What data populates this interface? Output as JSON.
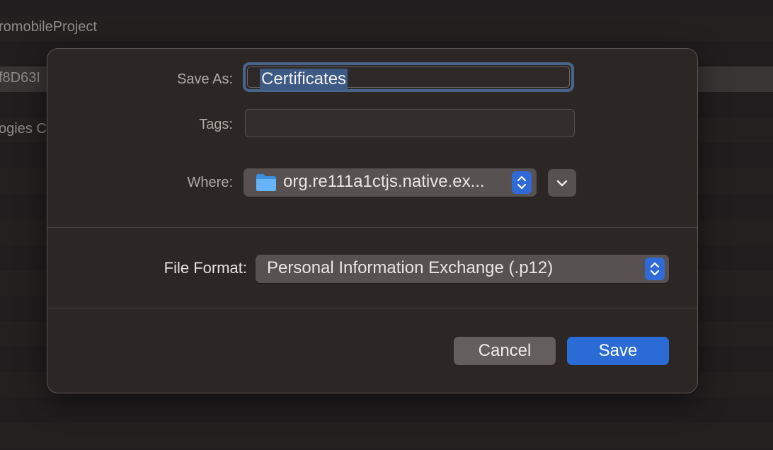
{
  "background": {
    "project_name": "romobileProject",
    "row_fragment_1": "f8D63I",
    "row_fragment_2": "ogies C"
  },
  "dialog": {
    "save_as_label": "Save As:",
    "save_as_value": "Certificates",
    "tags_label": "Tags:",
    "tags_value": "",
    "where_label": "Where:",
    "where_value": "org.re111a1ctjs.native.ex...",
    "where_icon": "folder-icon",
    "expand_icon": "chevron-down-icon",
    "file_format_label": "File Format:",
    "file_format_value": "Personal Information Exchange (.p12)",
    "cancel_label": "Cancel",
    "save_label": "Save"
  },
  "colors": {
    "accent": "#2a6bd6",
    "selection": "#3d5a84",
    "focus_ring": "#47658c"
  }
}
